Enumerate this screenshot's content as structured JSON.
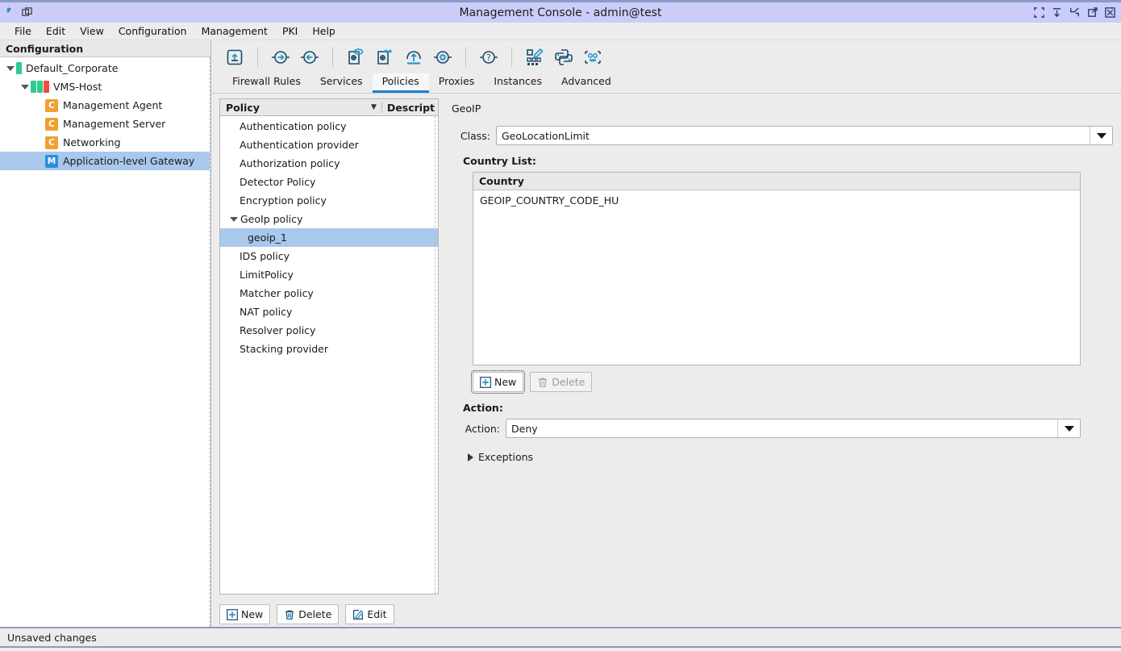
{
  "window": {
    "title": "Management Console - admin@test",
    "controls": [
      {
        "name": "restore-icon",
        "label": "Restore"
      },
      {
        "name": "minimize-down-icon",
        "label": "Minimize"
      },
      {
        "name": "shrink-icon",
        "label": "Shrink"
      },
      {
        "name": "maximize-icon",
        "label": "Maximize"
      },
      {
        "name": "close-icon",
        "label": "Close"
      }
    ]
  },
  "menu": {
    "items": [
      {
        "label": "File"
      },
      {
        "label": "Edit"
      },
      {
        "label": "View"
      },
      {
        "label": "Configuration"
      },
      {
        "label": "Management"
      },
      {
        "label": "PKI"
      },
      {
        "label": "Help"
      }
    ]
  },
  "sidebar": {
    "header": "Configuration",
    "items": [
      {
        "label": "Default_Corporate",
        "indent": 0,
        "twisty": "open",
        "bars": [
          "#2ecc8f"
        ],
        "badge": null,
        "selected": false
      },
      {
        "label": "VMS-Host",
        "indent": 1,
        "twisty": "open",
        "bars": [
          "#2ecc8f",
          "#2ecc8f",
          "#ee4b42"
        ],
        "badge": null,
        "selected": false
      },
      {
        "label": "Management Agent",
        "indent": 2,
        "twisty": "leaf",
        "bars": [],
        "badge": {
          "letter": "C",
          "color": "#f0a030"
        },
        "selected": false
      },
      {
        "label": "Management Server",
        "indent": 2,
        "twisty": "leaf",
        "bars": [],
        "badge": {
          "letter": "C",
          "color": "#f0a030"
        },
        "selected": false
      },
      {
        "label": "Networking",
        "indent": 2,
        "twisty": "leaf",
        "bars": [],
        "badge": {
          "letter": "C",
          "color": "#f0a030"
        },
        "selected": false
      },
      {
        "label": "Application-level Gateway",
        "indent": 2,
        "twisty": "leaf",
        "bars": [],
        "badge": {
          "letter": "M",
          "color": "#2b8fd8"
        },
        "selected": true
      }
    ]
  },
  "toolbar": {
    "buttons": [
      {
        "name": "go-up-icon",
        "label": "Up one level"
      },
      {
        "name": "sep",
        "label": ""
      },
      {
        "name": "forward-arrow-icon",
        "label": "Forward"
      },
      {
        "name": "back-arrow-icon",
        "label": "Back"
      },
      {
        "name": "sep",
        "label": ""
      },
      {
        "name": "preview-config-icon",
        "label": "Preview configuration"
      },
      {
        "name": "compare-config-icon",
        "label": "Compare configuration"
      },
      {
        "name": "upload-cloud-icon",
        "label": "Upload"
      },
      {
        "name": "settings-gear-icon",
        "label": "Settings"
      },
      {
        "name": "sep",
        "label": ""
      },
      {
        "name": "help-question-icon",
        "label": "Help"
      },
      {
        "name": "sep",
        "label": ""
      },
      {
        "name": "qr-edit-icon",
        "label": "Edit template"
      },
      {
        "name": "python-icon",
        "label": "Python console"
      },
      {
        "name": "robot-icon",
        "label": "Automation"
      }
    ]
  },
  "tabs": {
    "active": "Policies",
    "items": [
      {
        "label": "Firewall Rules"
      },
      {
        "label": "Services"
      },
      {
        "label": "Policies"
      },
      {
        "label": "Proxies"
      },
      {
        "label": "Instances"
      },
      {
        "label": "Advanced"
      }
    ]
  },
  "policy_list": {
    "columns": [
      {
        "label": "Policy",
        "sort": "descending"
      },
      {
        "label": "Descript"
      }
    ],
    "rows": [
      {
        "label": "Authentication policy",
        "level": 0,
        "twisty": "none",
        "selected": false
      },
      {
        "label": "Authentication provider",
        "level": 0,
        "twisty": "none",
        "selected": false
      },
      {
        "label": "Authorization policy",
        "level": 0,
        "twisty": "none",
        "selected": false
      },
      {
        "label": "Detector Policy",
        "level": 0,
        "twisty": "none",
        "selected": false
      },
      {
        "label": "Encryption policy",
        "level": 0,
        "twisty": "none",
        "selected": false
      },
      {
        "label": "GeoIp policy",
        "level": 0,
        "twisty": "open",
        "selected": false
      },
      {
        "label": "geoip_1",
        "level": 1,
        "twisty": "none",
        "selected": true
      },
      {
        "label": "IDS policy",
        "level": 0,
        "twisty": "none",
        "selected": false
      },
      {
        "label": "LimitPolicy",
        "level": 0,
        "twisty": "none",
        "selected": false
      },
      {
        "label": "Matcher policy",
        "level": 0,
        "twisty": "none",
        "selected": false
      },
      {
        "label": "NAT policy",
        "level": 0,
        "twisty": "none",
        "selected": false
      },
      {
        "label": "Resolver policy",
        "level": 0,
        "twisty": "none",
        "selected": false
      },
      {
        "label": "Stacking provider",
        "level": 0,
        "twisty": "none",
        "selected": false
      }
    ],
    "buttons": {
      "new": "New",
      "delete": "Delete",
      "edit": "Edit"
    }
  },
  "detail": {
    "title": "GeoIP",
    "class_label": "Class:",
    "class_value": "GeoLocationLimit",
    "country_list_label": "Country List:",
    "country_table": {
      "header": "Country",
      "rows": [
        "GEOIP_COUNTRY_CODE_HU"
      ]
    },
    "table_buttons": {
      "new": "New",
      "delete": "Delete",
      "delete_disabled": true,
      "new_focused": true
    },
    "action_section_label": "Action:",
    "action_label": "Action:",
    "action_value": "Deny",
    "exceptions_label": "Exceptions",
    "exceptions_expanded": false
  },
  "statusbar": {
    "message": "Unsaved changes"
  },
  "colors": {
    "titlebar": "#ccccf8",
    "accent_blue": "#1f7fd0",
    "selection": "#a8c8ec",
    "panel": "#ececec",
    "badge_orange": "#f0a030",
    "badge_blue": "#2b8fd8",
    "status_green": "#2ecc8f",
    "status_red": "#ee4b42"
  }
}
